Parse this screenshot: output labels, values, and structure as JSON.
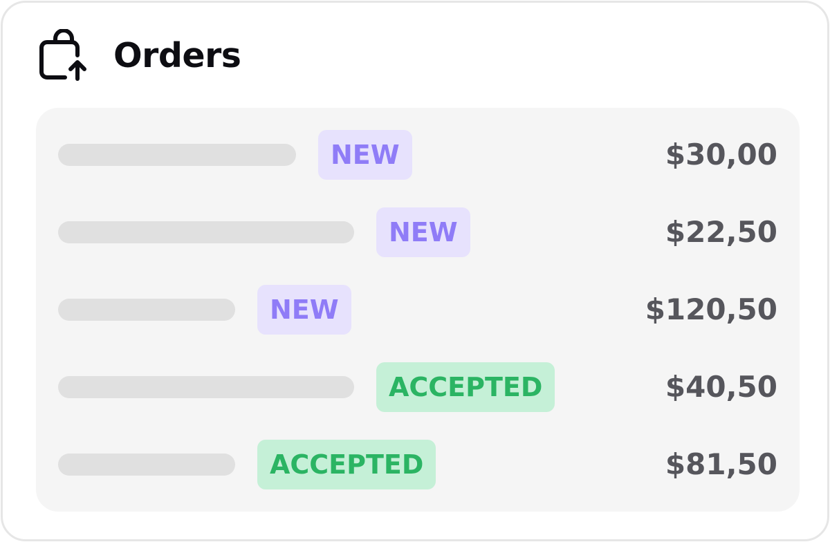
{
  "header": {
    "title": "Orders",
    "icon": "shopping-bag-upload-icon"
  },
  "orders": [
    {
      "status": "NEW",
      "price": "$30,00"
    },
    {
      "status": "NEW",
      "price": "$22,50"
    },
    {
      "status": "NEW",
      "price": "$120,50"
    },
    {
      "status": "ACCEPTED",
      "price": "$40,50"
    },
    {
      "status": "ACCEPTED",
      "price": "$81,50"
    }
  ],
  "colors": {
    "new_badge_bg": "#e7e2fd",
    "new_badge_text": "#8f7cf7",
    "accepted_badge_bg": "#c5f0d7",
    "accepted_badge_text": "#2bb463",
    "price_text": "#56565c",
    "placeholder": "#e0e0e0"
  }
}
